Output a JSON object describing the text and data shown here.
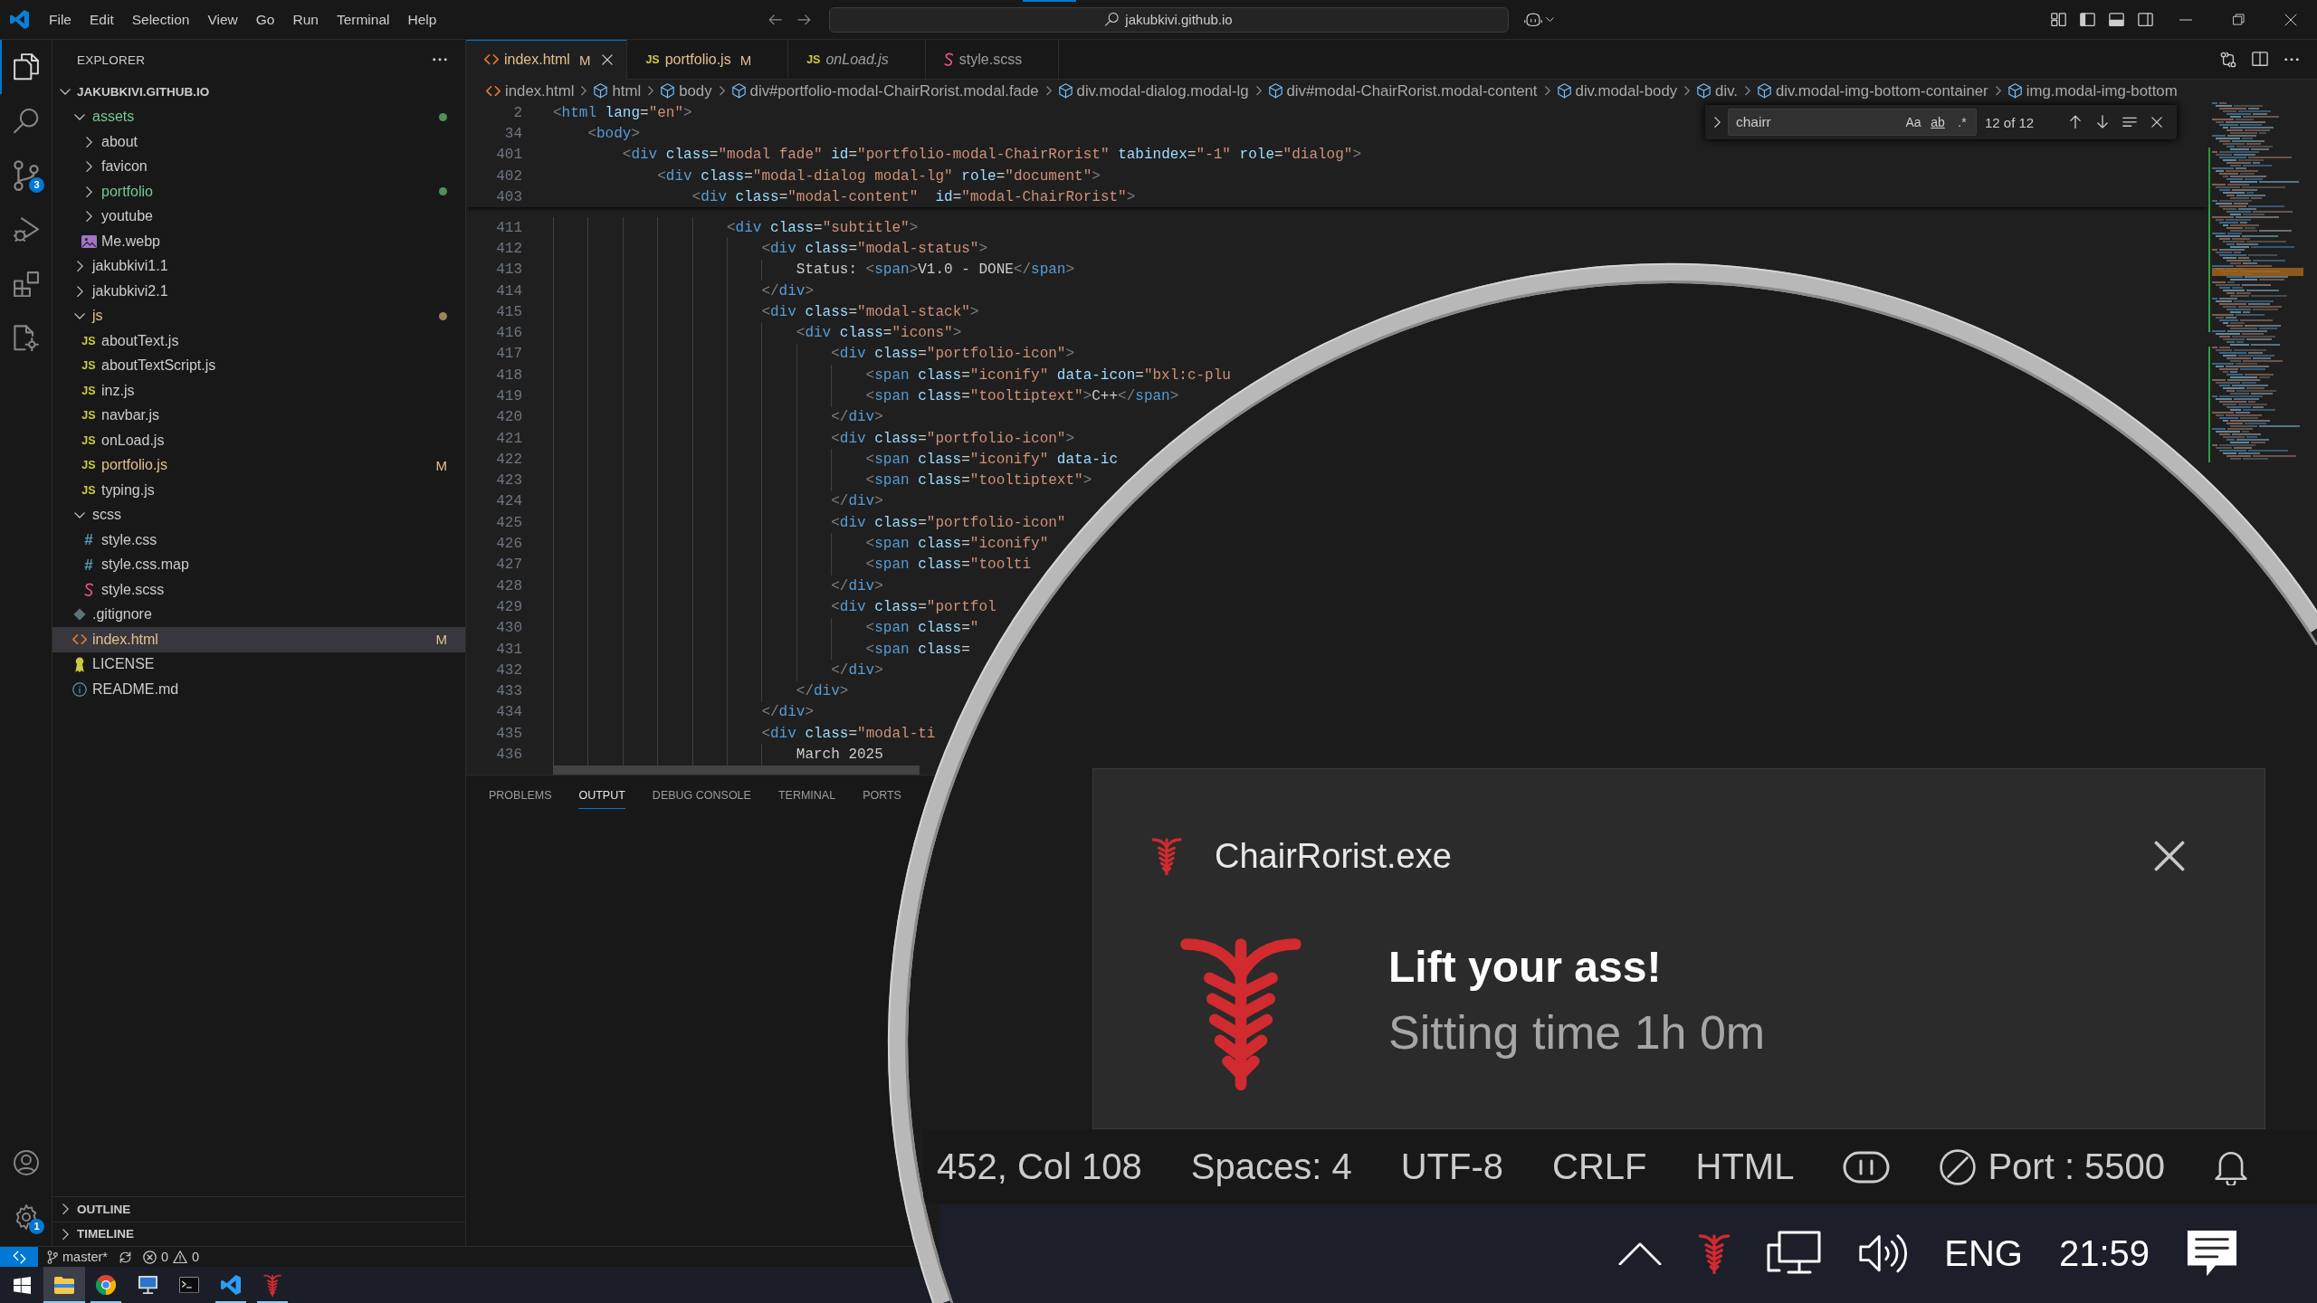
{
  "title_bar": {
    "menu": [
      "File",
      "Edit",
      "Selection",
      "View",
      "Go",
      "Run",
      "Terminal",
      "Help"
    ],
    "command_center": "jakubkivi.github.io"
  },
  "activity_bar": {
    "items": [
      {
        "kind": "explorer",
        "selected": true
      },
      {
        "kind": "search",
        "selected": false
      },
      {
        "kind": "source_control",
        "selected": false,
        "badge": "3"
      },
      {
        "kind": "run_debug",
        "selected": false
      },
      {
        "kind": "extensions",
        "selected": false
      },
      {
        "kind": "remote",
        "selected": false
      }
    ],
    "bottom": [
      {
        "kind": "accounts"
      },
      {
        "kind": "manage",
        "badge": "1"
      }
    ]
  },
  "sidebar": {
    "title": "EXPLORER",
    "root": {
      "name": "JAKUBKIVI.GITHUB.IO",
      "expanded": true
    },
    "tree": [
      {
        "name": "assets",
        "kind": "folder",
        "expanded": true,
        "modified": false,
        "untracked": true,
        "selected": false,
        "children": [
          {
            "name": "about",
            "kind": "folder",
            "expanded": false,
            "modified": false,
            "untracked": false,
            "selected": false
          },
          {
            "name": "favicon",
            "kind": "folder",
            "expanded": false,
            "modified": false,
            "untracked": false,
            "selected": false
          },
          {
            "name": "portfolio",
            "kind": "folder",
            "expanded": false,
            "modified": false,
            "untracked": true,
            "selected": false
          },
          {
            "name": "youtube",
            "kind": "folder",
            "expanded": false,
            "modified": false,
            "untracked": false,
            "selected": false
          },
          {
            "name": "Me.webp",
            "kind": "image",
            "modified": false,
            "untracked": false,
            "selected": false
          }
        ]
      },
      {
        "name": "jakubkivi1.1",
        "kind": "folder",
        "expanded": false,
        "modified": false,
        "untracked": false,
        "selected": false
      },
      {
        "name": "jakubkivi2.1",
        "kind": "folder",
        "expanded": false,
        "modified": false,
        "untracked": false,
        "selected": false
      },
      {
        "name": "js",
        "kind": "folder",
        "expanded": true,
        "modified": true,
        "untracked": false,
        "selected": false,
        "children": [
          {
            "name": "aboutText.js",
            "kind": "js",
            "glyph": "JS",
            "modified": false,
            "untracked": false,
            "selected": false
          },
          {
            "name": "aboutTextScript.js",
            "kind": "js",
            "glyph": "JS",
            "modified": false,
            "untracked": false,
            "selected": false
          },
          {
            "name": "inz.js",
            "kind": "js",
            "glyph": "JS",
            "modified": false,
            "untracked": false,
            "selected": false
          },
          {
            "name": "navbar.js",
            "kind": "js",
            "glyph": "JS",
            "modified": false,
            "untracked": false,
            "selected": false
          },
          {
            "name": "onLoad.js",
            "kind": "js",
            "glyph": "JS",
            "modified": false,
            "untracked": false,
            "selected": false
          },
          {
            "name": "portfolio.js",
            "kind": "js",
            "glyph": "JS",
            "modified": true,
            "untracked": false,
            "badge": "M",
            "selected": false
          },
          {
            "name": "typing.js",
            "kind": "js",
            "glyph": "JS",
            "modified": false,
            "untracked": false,
            "selected": false
          }
        ]
      },
      {
        "name": "scss",
        "kind": "folder",
        "expanded": true,
        "modified": false,
        "untracked": false,
        "selected": false,
        "children": [
          {
            "name": "style.css",
            "kind": "css",
            "glyph": "#",
            "modified": false,
            "untracked": false,
            "selected": false
          },
          {
            "name": "style.css.map",
            "kind": "css",
            "glyph": "#",
            "modified": false,
            "untracked": false,
            "selected": false
          },
          {
            "name": "style.scss",
            "kind": "scss",
            "modified": false,
            "untracked": false,
            "selected": false
          }
        ]
      },
      {
        "name": ".gitignore",
        "kind": "git",
        "modified": false,
        "untracked": false,
        "selected": false
      },
      {
        "name": "index.html",
        "kind": "html",
        "modified": true,
        "untracked": false,
        "badge": "M",
        "selected": true
      },
      {
        "name": "LICENSE",
        "kind": "license",
        "modified": false,
        "untracked": false,
        "selected": false
      },
      {
        "name": "README.md",
        "kind": "info",
        "modified": false,
        "untracked": false,
        "selected": false
      }
    ],
    "sections": [
      {
        "name": "OUTLINE",
        "expanded": false
      },
      {
        "name": "TIMELINE",
        "expanded": false
      }
    ]
  },
  "editor": {
    "tabs": [
      {
        "label": "index.html",
        "kind": "html",
        "modified": true,
        "badge": "M",
        "preview": false,
        "selected": true
      },
      {
        "label": "portfolio.js",
        "kind": "js",
        "glyph": "JS",
        "modified": true,
        "badge": "M",
        "preview": false,
        "selected": false
      },
      {
        "label": "onLoad.js",
        "kind": "js",
        "glyph": "JS",
        "modified": false,
        "preview": true,
        "selected": false
      },
      {
        "label": "style.scss",
        "kind": "scss",
        "modified": false,
        "preview": false,
        "selected": false
      }
    ],
    "breadcrumbs": [
      {
        "label": "index.html",
        "kind": "html"
      },
      {
        "label": "html",
        "kind": "element"
      },
      {
        "label": "body",
        "kind": "element"
      },
      {
        "label": "div#portfolio-modal-ChairRorist.modal.fade",
        "kind": "element"
      },
      {
        "label": "div.modal-dialog.modal-lg",
        "kind": "element"
      },
      {
        "label": "div#modal-ChairRorist.modal-content",
        "kind": "element"
      },
      {
        "label": "div.modal-body",
        "kind": "element"
      },
      {
        "label": "div.",
        "kind": "element"
      },
      {
        "label": "div.modal-img-bottom-container",
        "kind": "element"
      },
      {
        "label": "img.modal-img-bottom",
        "kind": "element"
      }
    ],
    "find": {
      "value": "chairr",
      "options": [
        {
          "kind": "match_case",
          "label": "Aa"
        },
        {
          "kind": "whole_word",
          "label": "ab"
        },
        {
          "kind": "regex",
          "label": ".*"
        }
      ],
      "result": "12 of 12"
    },
    "sticky_lines": [
      {
        "number": "2",
        "tokens": [
          {
            "kind": "bracket",
            "text": "<"
          },
          {
            "kind": "tag",
            "text": "html"
          },
          {
            "kind": "attribute",
            "text": " lang"
          },
          {
            "kind": "equals",
            "text": "="
          },
          {
            "kind": "string",
            "text": "\"en\""
          },
          {
            "kind": "bracket",
            "text": ">"
          }
        ]
      },
      {
        "number": "34",
        "tokens": [
          {
            "kind": "bracket",
            "text": "    <"
          },
          {
            "kind": "tag",
            "text": "body"
          },
          {
            "kind": "bracket",
            "text": ">"
          }
        ]
      },
      {
        "number": "401",
        "tokens": [
          {
            "kind": "bracket",
            "text": "        <"
          },
          {
            "kind": "tag",
            "text": "div"
          },
          {
            "kind": "attribute",
            "text": " class"
          },
          {
            "kind": "equals",
            "text": "="
          },
          {
            "kind": "string",
            "text": "\"modal fade\""
          },
          {
            "kind": "attribute",
            "text": " id"
          },
          {
            "kind": "equals",
            "text": "="
          },
          {
            "kind": "string",
            "text": "\"portfolio-modal-ChairRorist\""
          },
          {
            "kind": "attribute",
            "text": " tabindex"
          },
          {
            "kind": "equals",
            "text": "="
          },
          {
            "kind": "string",
            "text": "\"-1\""
          },
          {
            "kind": "attribute",
            "text": " role"
          },
          {
            "kind": "equals",
            "text": "="
          },
          {
            "kind": "string",
            "text": "\"dialog\""
          },
          {
            "kind": "bracket",
            "text": ">"
          }
        ]
      },
      {
        "number": "402",
        "tokens": [
          {
            "kind": "bracket",
            "text": "            <"
          },
          {
            "kind": "tag",
            "text": "div"
          },
          {
            "kind": "attribute",
            "text": " class"
          },
          {
            "kind": "equals",
            "text": "="
          },
          {
            "kind": "string",
            "text": "\"modal-dialog modal-lg\""
          },
          {
            "kind": "attribute",
            "text": " role"
          },
          {
            "kind": "equals",
            "text": "="
          },
          {
            "kind": "string",
            "text": "\"document\""
          },
          {
            "kind": "bracket",
            "text": ">"
          }
        ]
      },
      {
        "number": "403",
        "tokens": [
          {
            "kind": "bracket",
            "text": "                <"
          },
          {
            "kind": "tag",
            "text": "div"
          },
          {
            "kind": "attribute",
            "text": " class"
          },
          {
            "kind": "equals",
            "text": "="
          },
          {
            "kind": "string",
            "text": "\"modal-content\""
          },
          {
            "kind": "attribute",
            "text": "  id"
          },
          {
            "kind": "equals",
            "text": "="
          },
          {
            "kind": "string",
            "text": "\"modal-ChairRorist\""
          },
          {
            "kind": "bracket",
            "text": ">"
          }
        ]
      }
    ],
    "lines": [
      {
        "number": "411",
        "tokens": [
          {
            "kind": "bracket",
            "text": "                    <"
          },
          {
            "kind": "tag",
            "text": "div"
          },
          {
            "kind": "attribute",
            "text": " class"
          },
          {
            "kind": "equals",
            "text": "="
          },
          {
            "kind": "string",
            "text": "\"subtitle\""
          },
          {
            "kind": "bracket",
            "text": ">"
          }
        ]
      },
      {
        "number": "412",
        "tokens": [
          {
            "kind": "bracket",
            "text": "                        <"
          },
          {
            "kind": "tag",
            "text": "div"
          },
          {
            "kind": "attribute",
            "text": " class"
          },
          {
            "kind": "equals",
            "text": "="
          },
          {
            "kind": "string",
            "text": "\"modal-status\""
          },
          {
            "kind": "bracket",
            "text": ">"
          }
        ]
      },
      {
        "number": "413",
        "tokens": [
          {
            "kind": "text",
            "text": "                            Status: "
          },
          {
            "kind": "bracket",
            "text": "<"
          },
          {
            "kind": "tag",
            "text": "span"
          },
          {
            "kind": "bracket",
            "text": ">"
          },
          {
            "kind": "text",
            "text": "V1.0 - DONE"
          },
          {
            "kind": "bracket",
            "text": "</"
          },
          {
            "kind": "tag",
            "text": "span"
          },
          {
            "kind": "bracket",
            "text": ">"
          }
        ]
      },
      {
        "number": "414",
        "tokens": [
          {
            "kind": "bracket",
            "text": "                        </"
          },
          {
            "kind": "tag",
            "text": "div"
          },
          {
            "kind": "bracket",
            "text": ">"
          }
        ]
      },
      {
        "number": "415",
        "tokens": [
          {
            "kind": "bracket",
            "text": "                        <"
          },
          {
            "kind": "tag",
            "text": "div"
          },
          {
            "kind": "attribute",
            "text": " class"
          },
          {
            "kind": "equals",
            "text": "="
          },
          {
            "kind": "string",
            "text": "\"modal-stack\""
          },
          {
            "kind": "bracket",
            "text": ">"
          }
        ]
      },
      {
        "number": "416",
        "tokens": [
          {
            "kind": "bracket",
            "text": "                            <"
          },
          {
            "kind": "tag",
            "text": "div"
          },
          {
            "kind": "attribute",
            "text": " class"
          },
          {
            "kind": "equals",
            "text": "="
          },
          {
            "kind": "string",
            "text": "\"icons\""
          },
          {
            "kind": "bracket",
            "text": ">"
          }
        ]
      },
      {
        "number": "417",
        "tokens": [
          {
            "kind": "bracket",
            "text": "                                <"
          },
          {
            "kind": "tag",
            "text": "div"
          },
          {
            "kind": "attribute",
            "text": " class"
          },
          {
            "kind": "equals",
            "text": "="
          },
          {
            "kind": "string",
            "text": "\"portfolio-icon\""
          },
          {
            "kind": "bracket",
            "text": ">"
          }
        ]
      },
      {
        "number": "418",
        "tokens": [
          {
            "kind": "bracket",
            "text": "                                    <"
          },
          {
            "kind": "tag",
            "text": "span"
          },
          {
            "kind": "attribute",
            "text": " class"
          },
          {
            "kind": "equals",
            "text": "="
          },
          {
            "kind": "string",
            "text": "\"iconify\""
          },
          {
            "kind": "attribute",
            "text": " data-icon"
          },
          {
            "kind": "equals",
            "text": "="
          },
          {
            "kind": "string",
            "text": "\"bxl:c-plu"
          }
        ]
      },
      {
        "number": "419",
        "tokens": [
          {
            "kind": "bracket",
            "text": "                                    <"
          },
          {
            "kind": "tag",
            "text": "span"
          },
          {
            "kind": "attribute",
            "text": " class"
          },
          {
            "kind": "equals",
            "text": "="
          },
          {
            "kind": "string",
            "text": "\"tooltiptext\""
          },
          {
            "kind": "bracket",
            "text": ">"
          },
          {
            "kind": "text",
            "text": "C++"
          },
          {
            "kind": "bracket",
            "text": "</"
          },
          {
            "kind": "tag",
            "text": "span"
          },
          {
            "kind": "bracket",
            "text": ">"
          }
        ]
      },
      {
        "number": "420",
        "tokens": [
          {
            "kind": "bracket",
            "text": "                                </"
          },
          {
            "kind": "tag",
            "text": "div"
          },
          {
            "kind": "bracket",
            "text": ">"
          }
        ]
      },
      {
        "number": "421",
        "tokens": [
          {
            "kind": "bracket",
            "text": "                                <"
          },
          {
            "kind": "tag",
            "text": "div"
          },
          {
            "kind": "attribute",
            "text": " class"
          },
          {
            "kind": "equals",
            "text": "="
          },
          {
            "kind": "string",
            "text": "\"portfolio-icon\""
          },
          {
            "kind": "bracket",
            "text": ">"
          }
        ]
      },
      {
        "number": "422",
        "tokens": [
          {
            "kind": "bracket",
            "text": "                                    <"
          },
          {
            "kind": "tag",
            "text": "span"
          },
          {
            "kind": "attribute",
            "text": " class"
          },
          {
            "kind": "equals",
            "text": "="
          },
          {
            "kind": "string",
            "text": "\"iconify\""
          },
          {
            "kind": "attribute",
            "text": " data-ic"
          }
        ]
      },
      {
        "number": "423",
        "tokens": [
          {
            "kind": "bracket",
            "text": "                                    <"
          },
          {
            "kind": "tag",
            "text": "span"
          },
          {
            "kind": "attribute",
            "text": " class"
          },
          {
            "kind": "equals",
            "text": "="
          },
          {
            "kind": "string",
            "text": "\"tooltiptext\""
          },
          {
            "kind": "bracket",
            "text": ">"
          }
        ]
      },
      {
        "number": "424",
        "tokens": [
          {
            "kind": "bracket",
            "text": "                                </"
          },
          {
            "kind": "tag",
            "text": "div"
          },
          {
            "kind": "bracket",
            "text": ">"
          }
        ]
      },
      {
        "number": "425",
        "tokens": [
          {
            "kind": "bracket",
            "text": "                                <"
          },
          {
            "kind": "tag",
            "text": "div"
          },
          {
            "kind": "attribute",
            "text": " class"
          },
          {
            "kind": "equals",
            "text": "="
          },
          {
            "kind": "string",
            "text": "\"portfolio-icon\""
          }
        ]
      },
      {
        "number": "426",
        "tokens": [
          {
            "kind": "bracket",
            "text": "                                    <"
          },
          {
            "kind": "tag",
            "text": "span"
          },
          {
            "kind": "attribute",
            "text": " class"
          },
          {
            "kind": "equals",
            "text": "="
          },
          {
            "kind": "string",
            "text": "\"iconify\""
          }
        ]
      },
      {
        "number": "427",
        "tokens": [
          {
            "kind": "bracket",
            "text": "                                    <"
          },
          {
            "kind": "tag",
            "text": "span"
          },
          {
            "kind": "attribute",
            "text": " class"
          },
          {
            "kind": "equals",
            "text": "="
          },
          {
            "kind": "string",
            "text": "\"toolti"
          }
        ]
      },
      {
        "number": "428",
        "tokens": [
          {
            "kind": "bracket",
            "text": "                                </"
          },
          {
            "kind": "tag",
            "text": "div"
          },
          {
            "kind": "bracket",
            "text": ">"
          }
        ]
      },
      {
        "number": "429",
        "tokens": [
          {
            "kind": "bracket",
            "text": "                                <"
          },
          {
            "kind": "tag",
            "text": "div"
          },
          {
            "kind": "attribute",
            "text": " class"
          },
          {
            "kind": "equals",
            "text": "="
          },
          {
            "kind": "string",
            "text": "\"portfol"
          }
        ]
      },
      {
        "number": "430",
        "tokens": [
          {
            "kind": "bracket",
            "text": "                                    <"
          },
          {
            "kind": "tag",
            "text": "span"
          },
          {
            "kind": "attribute",
            "text": " class"
          },
          {
            "kind": "equals",
            "text": "="
          },
          {
            "kind": "string",
            "text": "\""
          }
        ]
      },
      {
        "number": "431",
        "tokens": [
          {
            "kind": "bracket",
            "text": "                                    <"
          },
          {
            "kind": "tag",
            "text": "span"
          },
          {
            "kind": "attribute",
            "text": " class"
          },
          {
            "kind": "equals",
            "text": "="
          }
        ]
      },
      {
        "number": "432",
        "tokens": [
          {
            "kind": "bracket",
            "text": "                                </"
          },
          {
            "kind": "tag",
            "text": "div"
          },
          {
            "kind": "bracket",
            "text": ">"
          }
        ]
      },
      {
        "number": "433",
        "tokens": [
          {
            "kind": "bracket",
            "text": "                            </"
          },
          {
            "kind": "tag",
            "text": "div"
          },
          {
            "kind": "bracket",
            "text": ">"
          }
        ]
      },
      {
        "number": "434",
        "tokens": [
          {
            "kind": "bracket",
            "text": "                        </"
          },
          {
            "kind": "tag",
            "text": "div"
          },
          {
            "kind": "bracket",
            "text": ">"
          }
        ]
      },
      {
        "number": "435",
        "tokens": [
          {
            "kind": "bracket",
            "text": "                        <"
          },
          {
            "kind": "tag",
            "text": "div"
          },
          {
            "kind": "attribute",
            "text": " class"
          },
          {
            "kind": "equals",
            "text": "="
          },
          {
            "kind": "string",
            "text": "\"modal-ti"
          }
        ]
      },
      {
        "number": "436",
        "tokens": [
          {
            "kind": "text",
            "text": "                            March 2025"
          }
        ]
      }
    ]
  },
  "panel": {
    "tabs": [
      {
        "label": "PROBLEMS",
        "selected": false
      },
      {
        "label": "OUTPUT",
        "selected": true
      },
      {
        "label": "DEBUG CONSOLE",
        "selected": false
      },
      {
        "label": "TERMINAL",
        "selected": false
      },
      {
        "label": "PORTS",
        "selected": false
      }
    ]
  },
  "status_bar": {
    "branch": "master*",
    "problems": [
      {
        "kind": "error",
        "count": "0"
      },
      {
        "kind": "warning",
        "count": "0"
      }
    ]
  },
  "taskbar": {
    "apps": [
      {
        "kind": "files",
        "running": true,
        "selected": true
      },
      {
        "kind": "browser",
        "running": true,
        "selected": false
      },
      {
        "kind": "remote_desktop",
        "running": false,
        "selected": false
      },
      {
        "kind": "terminal",
        "running": false,
        "selected": false
      },
      {
        "kind": "editor",
        "running": true,
        "selected": false
      },
      {
        "kind": "chairrorist",
        "running": true,
        "selected": false
      }
    ]
  },
  "magnifier": {
    "notification": {
      "app": "ChairRorist.exe",
      "title": "Lift your ass!",
      "message": "Sitting time 1h 0m"
    },
    "status_items": [
      {
        "kind": "text",
        "label": "452, Col 108"
      },
      {
        "kind": "text",
        "label": "Spaces: 4"
      },
      {
        "kind": "text",
        "label": "UTF-8"
      },
      {
        "kind": "text",
        "label": "CRLF"
      },
      {
        "kind": "text",
        "label": "HTML"
      },
      {
        "kind": "face"
      },
      {
        "kind": "port",
        "label": "Port : 5500"
      },
      {
        "kind": "bell"
      }
    ],
    "tray": [
      {
        "kind": "overflow"
      },
      {
        "kind": "chairrorist"
      },
      {
        "kind": "network"
      },
      {
        "kind": "volume"
      },
      {
        "kind": "text",
        "label": "ENG"
      },
      {
        "kind": "text",
        "label": "21:59"
      },
      {
        "kind": "notifications"
      }
    ]
  }
}
